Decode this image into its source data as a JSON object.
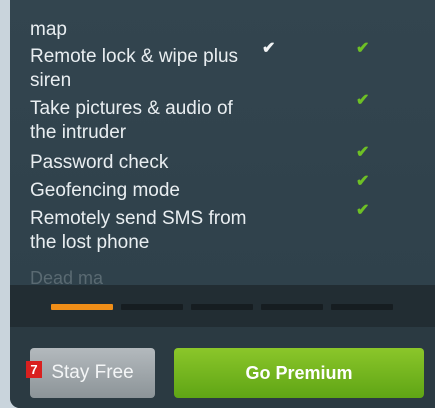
{
  "features": [
    {
      "label": "map",
      "free_check": false,
      "premium_check": false
    },
    {
      "label": "Remote lock & wipe plus siren",
      "free_check": true,
      "premium_check": true
    },
    {
      "label": "Take pictures & audio of the intruder",
      "free_check": false,
      "premium_check": true
    },
    {
      "label": "Password check",
      "free_check": false,
      "premium_check": true
    },
    {
      "label": "Geofencing mode",
      "free_check": false,
      "premium_check": true
    },
    {
      "label": "Remotely send SMS from the lost phone",
      "free_check": false,
      "premium_check": true
    }
  ],
  "faded_label": "Dead ma",
  "check_glyph": "✔",
  "pager": {
    "count": 5,
    "active_index": 0
  },
  "badge": "7",
  "actions": {
    "stay_free_label": "Stay Free",
    "go_premium_label": "Go Premium"
  },
  "colors": {
    "accent": "#f08e18",
    "check_premium": "#6ec025",
    "premium_button": "#74b51f"
  }
}
